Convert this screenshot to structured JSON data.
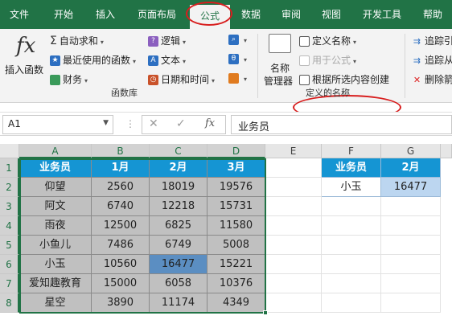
{
  "tabs": [
    "文件",
    "开始",
    "插入",
    "页面布局",
    "公式",
    "数据",
    "审阅",
    "视图",
    "开发工具",
    "帮助"
  ],
  "ribbon": {
    "insert_function": "插入函数",
    "autosum": "自动求和",
    "recent": "最近使用的函数",
    "finance": "财务",
    "logic": "逻辑",
    "text": "文本",
    "datetime": "日期和时间",
    "group_library": "函数库",
    "name_manager_1": "名称",
    "name_manager_2": "管理器",
    "define_name": "定义名称",
    "use_in_formula": "用于公式",
    "create_from_selection": "根据所选内容创建",
    "group_defined_names": "定义的名称",
    "trace_precedents": "追踪引",
    "trace_dependents": "追踪从",
    "remove_arrows": "删除箭"
  },
  "formula_bar": {
    "name_box": "A1",
    "fx": "fx",
    "value": "业务员"
  },
  "columns": [
    "A",
    "B",
    "C",
    "D",
    "E",
    "F",
    "G"
  ],
  "rows": [
    "1",
    "2",
    "3",
    "4",
    "5",
    "6",
    "7",
    "8"
  ],
  "table": {
    "headers": [
      "业务员",
      "1月",
      "2月",
      "3月"
    ],
    "rows": [
      [
        "仰望",
        "2560",
        "18019",
        "19576"
      ],
      [
        "阿文",
        "6740",
        "12218",
        "15731"
      ],
      [
        "雨夜",
        "12500",
        "6825",
        "11580"
      ],
      [
        "小鱼儿",
        "7486",
        "6749",
        "5008"
      ],
      [
        "小玉",
        "10560",
        "16477",
        "15221"
      ],
      [
        "爱知趣教育",
        "15000",
        "6058",
        "10376"
      ],
      [
        "星空",
        "3890",
        "11174",
        "4349"
      ]
    ]
  },
  "lookup": {
    "headers": [
      "业务员",
      "2月"
    ],
    "name": "小玉",
    "value": "16477"
  },
  "colors": {
    "accent": "#217346",
    "header_fill": "#1595d3",
    "table_fill": "#c0c0c0",
    "highlight": "#5b8ec2",
    "lookup_value": "#bcd6f0",
    "annotation": "#d81e1e"
  }
}
